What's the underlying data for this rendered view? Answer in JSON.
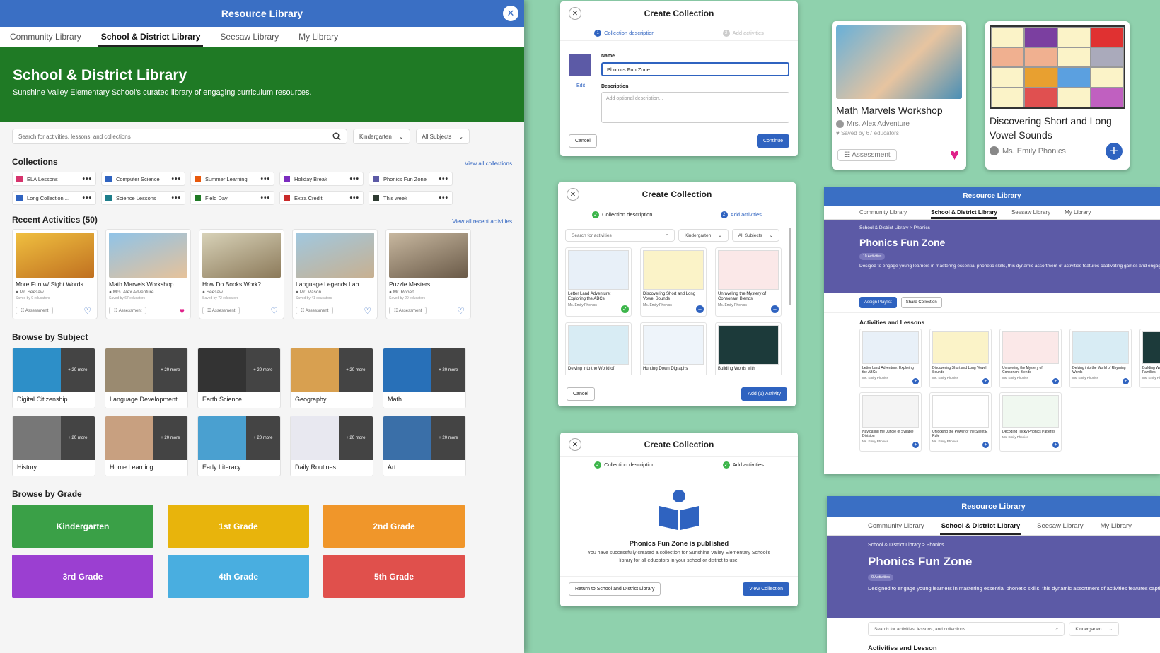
{
  "main": {
    "title": "Resource Library",
    "tabs": [
      "Community Library",
      "School & District Library",
      "Seesaw Library",
      "My Library"
    ],
    "hero_title": "School & District Library",
    "hero_sub": "Sunshine Valley Elementary School's curated library of engaging curriculum resources.",
    "search_placeholder": "Search for activities, lessons, and collections",
    "grade_filter": "Kindergarten",
    "subject_filter": "All Subjects",
    "collections_title": "Collections",
    "view_all_collections": "View all collections",
    "collections": [
      {
        "label": "ELA Lessons",
        "color": "#d6336c"
      },
      {
        "label": "Computer Science",
        "color": "#2f63c0"
      },
      {
        "label": "Summer Learning",
        "color": "#e8590c"
      },
      {
        "label": "Holiday Break",
        "color": "#7b2cbf"
      },
      {
        "label": "Phonics Fun Zone",
        "color": "#5c5aa6"
      },
      {
        "label": "Long Collection ...",
        "color": "#2f63c0"
      },
      {
        "label": "Science Lessons",
        "color": "#1d7d8a"
      },
      {
        "label": "Field Day",
        "color": "#1f7a25"
      },
      {
        "label": "Extra Credit",
        "color": "#c92a2a"
      },
      {
        "label": "This week",
        "color": "#2d3a30"
      }
    ],
    "recent_title": "Recent Activities (50)",
    "view_all_recent": "View all recent activities",
    "recent": [
      {
        "title": "More Fun w/ Sight Words",
        "author": "Mr. Seesaw",
        "saved": "Saved by 9 educators",
        "liked": false
      },
      {
        "title": "Math Marvels Workshop",
        "author": "Mrs. Alex Adventure",
        "saved": "Saved by 67 educators",
        "liked": true
      },
      {
        "title": "How Do Books Work?",
        "author": "Seesaw",
        "saved": "Saved by 72 educators",
        "liked": false
      },
      {
        "title": "Language Legends Lab",
        "author": "Mr. Mason",
        "saved": "Saved by 41 educators",
        "liked": false
      },
      {
        "title": "Puzzle Masters",
        "author": "Mr. Robert",
        "saved": "Saved by 29 educators",
        "liked": false
      }
    ],
    "assessment_label": "Assessment",
    "subject_title": "Browse by Subject",
    "more_label": "+ 20 more",
    "subjects": [
      "Digital Citizenship",
      "Language Development",
      "Earth Science",
      "Geography",
      "Math",
      "History",
      "Home Learning",
      "Early Literacy",
      "Daily Routines",
      "Art"
    ],
    "grade_title": "Browse by Grade",
    "grades": [
      {
        "label": "Kindergarten",
        "color": "#3aa047"
      },
      {
        "label": "1st Grade",
        "color": "#e8b40c"
      },
      {
        "label": "2nd Grade",
        "color": "#f0962a"
      },
      {
        "label": "3rd Grade",
        "color": "#9b3fd1"
      },
      {
        "label": "4th Grade",
        "color": "#49aee0"
      },
      {
        "label": "5th Grade",
        "color": "#e0504c"
      }
    ]
  },
  "modal1": {
    "title": "Create Collection",
    "step1": "Collection description",
    "step2": "Add activities",
    "edit": "Edit",
    "name_label": "Name",
    "name_value": "Phonics Fun Zone",
    "desc_label": "Description",
    "desc_placeholder": "Add optional description...",
    "cancel": "Cancel",
    "continue": "Continue"
  },
  "modal2": {
    "title": "Create Collection",
    "step1": "Collection description",
    "step2": "Add activities",
    "search_placeholder": "Search for activities",
    "grade": "Kindergarten",
    "subject": "All Subjects",
    "items": [
      {
        "title": "Letter Land Adventure: Exploring the ABCs",
        "author": "Ms. Emily Phonics",
        "added": true
      },
      {
        "title": "Discovering Short and Long Vowel Sounds",
        "author": "Ms. Emily Phonics",
        "added": false
      },
      {
        "title": "Unraveling the Mystery of Consonant Blends",
        "author": "Ms. Emily Phonics",
        "added": false
      },
      {
        "title": "Delving into the World of",
        "author": "",
        "added": false
      },
      {
        "title": "Hunting Down Digraphs",
        "author": "",
        "added": false
      },
      {
        "title": "Building Words with",
        "author": "",
        "added": false
      }
    ],
    "cancel": "Cancel",
    "add": "Add (1) Activity"
  },
  "modal3": {
    "title": "Create Collection",
    "step1": "Collection description",
    "step2": "Add activities",
    "published": "Phonics Fun Zone is published",
    "message": "You have successfully created a collection for Sunshine Valley Elementary School's library for all educators in your school or district to use.",
    "return": "Return to School and District Library",
    "view": "View Collection"
  },
  "card1": {
    "title": "Math Marvels Workshop",
    "author": "Mrs. Alex Adventure",
    "saved": "Saved by 67 educators",
    "badge": "Assessment"
  },
  "card2": {
    "title": "Discovering Short and Long Vowel Sounds",
    "author": "Ms. Emily Phonics"
  },
  "panel1": {
    "title": "Resource Library",
    "tabs": [
      "Community Library",
      "School & District Library",
      "Seesaw Library",
      "My Library"
    ],
    "breadcrumb": "School & District Library > Phonics",
    "heading": "Phonics Fun Zone",
    "count": "10 Activities",
    "desc": "Desiged to engage young learners in mastering essential phonetic skills, this dynamic assortment of activities features captivating games and engaging challenges. From letter recognition to blending sounds, each activity is carefully crafted to build strong foundational literacy skills and enjoyable way.",
    "assign": "Assign Playlist",
    "share": "Share Collection",
    "section": "Activities and Lessons",
    "items": [
      "Letter Land Adventure: Exploring the ABCs",
      "Discovering Short and Long Vowel Sounds",
      "Unraveling the Mystery of Consonant Blends",
      "Delving into the World of Rhyming Words",
      "Building Words with Common Word Families",
      "Navigating the Jungle of Syllable Division",
      "Unlocking the Power of the Silent E Rule",
      "Decoding Tricky Phonics Patterns"
    ],
    "author": "Ms. Emily Phonics"
  },
  "panel2": {
    "title": "Resource Library",
    "tabs": [
      "Community Library",
      "School & District Library",
      "Seesaw Library",
      "My Library"
    ],
    "breadcrumb": "School & District Library > Phonics",
    "heading": "Phonics Fun Zone",
    "count": "0 Activities",
    "desc": "Designed to engage young learners in mastering essential phonetic skills, this dynamic assortment of activities features captivating games and engaging challenges. From letter recognition to blending sounds, each activity is carefully crafted to build strong foundational literacy skills and enjoyable way.",
    "search_placeholder": "Search for activities, lessons, and collections",
    "grade": "Kindergarten",
    "section": "Activities and Lesson"
  }
}
